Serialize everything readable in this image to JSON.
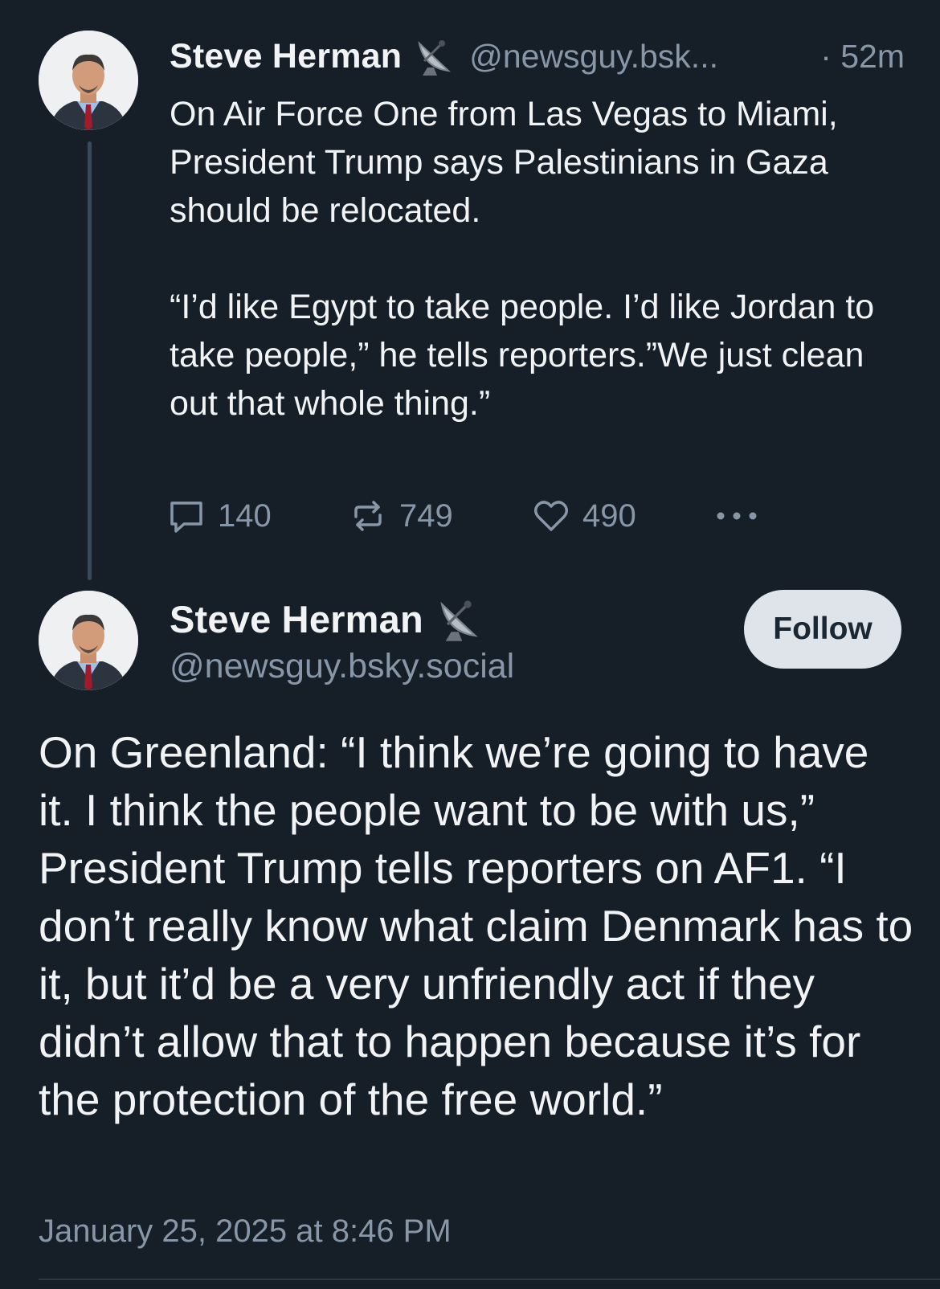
{
  "post1": {
    "author_name": "Steve Herman",
    "badge_icon": "satellite-dish-icon",
    "handle": "@newsguy.bsk...",
    "time": "· 52m",
    "text": "On Air Force One from Las Vegas to Miami, President Trump says Palestinians in Gaza should be relocated.\n\n“I’d like Egypt to take people. I’d like Jordan to take people,” he tells reporters.”We just clean out that whole thing.”",
    "replies": "140",
    "reposts": "749",
    "likes": "490"
  },
  "post2": {
    "author_name": "Steve Herman",
    "badge_icon": "satellite-dish-icon",
    "handle": "@newsguy.bsky.social",
    "follow_label": "Follow",
    "text": "On Greenland: “I think we’re going to have it. I think the people want to be with us,” President Trump tells reporters on AF1. “I don’t really know what claim Denmark has to it, but it’d be a very unfriendly act if they didn’t allow that to happen because it’s for the protection of the free world.”",
    "date": "January 25, 2025 at 8:46 PM"
  },
  "colors": {
    "background": "#161e27",
    "text": "#f1f3f5",
    "muted": "#8897a8",
    "follow_button": "#dfe4ea"
  }
}
